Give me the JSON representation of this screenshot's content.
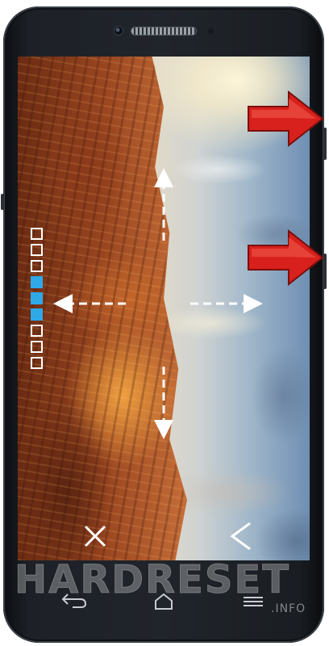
{
  "device": {
    "volume_level": {
      "total": 9,
      "filled": [
        3,
        4,
        5
      ]
    }
  },
  "overlay": {
    "close_icon": "close-x-icon",
    "back_icon": "chevron-left-icon",
    "gesture_arrows": [
      "swipe-up-arrow",
      "swipe-down-arrow",
      "swipe-left-arrow",
      "swipe-right-arrow"
    ]
  },
  "annotations": {
    "callout_arrows": [
      "red-arrow-volume-up",
      "red-arrow-volume-down"
    ]
  },
  "navbar": {
    "back_icon": "back-icon",
    "home_icon": "home-icon",
    "menu_icon": "menu-icon"
  },
  "watermark": {
    "main": "HARDRESET",
    "sub": ".INFO"
  },
  "colors": {
    "level_on": "#2fa8e8",
    "arrow_red": "#d8201c"
  }
}
